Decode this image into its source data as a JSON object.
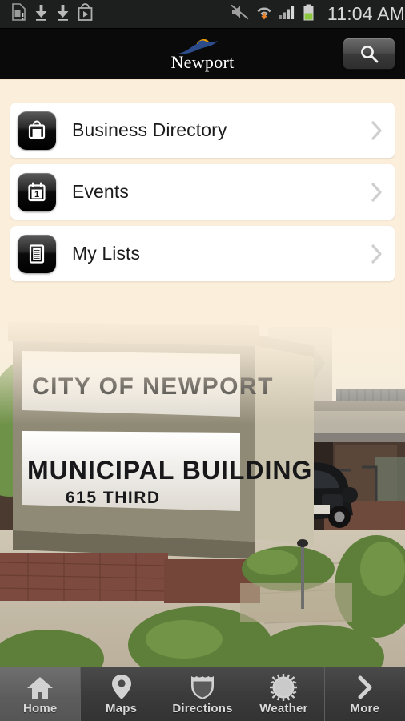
{
  "statusbar": {
    "time": "11:04 AM",
    "left_icons": [
      "sim-card-alert-icon",
      "download-icon",
      "download-icon",
      "play-store-icon"
    ],
    "right_icons": [
      "mute-icon",
      "wifi-download-icon",
      "signal-bars-icon",
      "battery-icon"
    ],
    "battery_color": "#8DC63F"
  },
  "header": {
    "logo_text": "Newport",
    "logo_sun_color": "#F5A300",
    "logo_swoosh_color": "#2C4C8C",
    "search_icon": "search-icon"
  },
  "menu": {
    "items": [
      {
        "label": "Business Directory",
        "icon": "briefcase-icon"
      },
      {
        "label": "Events",
        "icon": "calendar-icon",
        "calendar_day": "1"
      },
      {
        "label": "My Lists",
        "icon": "list-icon"
      }
    ],
    "chevron_icon": "chevron-right-icon"
  },
  "photo": {
    "sign_line1": "CITY OF NEWPORT",
    "sign_line2": "MUNICIPAL BUILDING",
    "sign_line3": "615 THIRD",
    "description": "City of Newport Municipal Building exterior with marquee sign"
  },
  "tabbar": {
    "tabs": [
      {
        "label": "Home",
        "icon": "home-icon",
        "active": true
      },
      {
        "label": "Maps",
        "icon": "map-pin-icon",
        "active": false
      },
      {
        "label": "Directions",
        "icon": "shield-icon",
        "active": false
      },
      {
        "label": "Weather",
        "icon": "sun-icon",
        "active": false
      },
      {
        "label": "More",
        "icon": "chevron-right-icon",
        "active": false
      }
    ]
  },
  "colors": {
    "background": "#FBEFDC",
    "card": "#FFFFFF",
    "header_bar": "#0A0A0A",
    "tabbar": "#3B3B3B"
  }
}
